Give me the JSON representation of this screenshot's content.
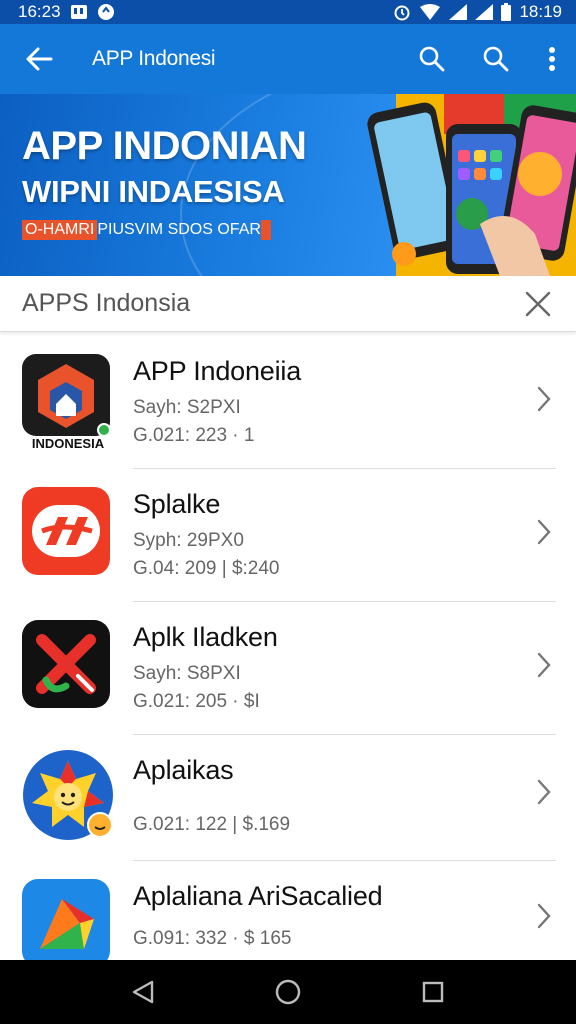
{
  "status_bar": {
    "time_left": "16:23",
    "time_right": "18:19"
  },
  "app_bar": {
    "title": "APP Indonesi",
    "icons": [
      "back-arrow-icon",
      "search-icon",
      "search-icon",
      "more-vert-icon"
    ]
  },
  "banner": {
    "line1": "APP INDONIAN",
    "line2": "WIPNI INDAESISA",
    "tag_highlight": "O-HAMRI",
    "tag_text": " PIUSVIM SDOS OFAR"
  },
  "search": {
    "query": "APPS Indonsia"
  },
  "apps": [
    {
      "name": "APP Indoneiia",
      "meta": "Sayh: S2PXI",
      "meta2": "G.021: 223 · 1",
      "icon_label": "INDONESIA",
      "icon": "indonesia-app-icon"
    },
    {
      "name": "Splalke",
      "meta": "Syph: 29PX0",
      "meta2": "G.04: 209 | $:240",
      "icon": "splalke-app-icon"
    },
    {
      "name": "Aplk Iladken",
      "meta": "Sayh: S8PXI",
      "meta2": "G.021: 205 · $I",
      "icon": "aplk-app-icon"
    },
    {
      "name": "Aplaikas",
      "meta": "",
      "meta2": "G.021: 122 | $.169",
      "icon": "aplaikas-app-icon"
    },
    {
      "name": "Aplaliana AriSacalied",
      "meta": "",
      "meta2": "G.091: 332 · $ 165",
      "icon": "aplaliana-app-icon"
    }
  ],
  "colors": {
    "app_bar": "#1478d8",
    "status_bar": "#0b4fa8",
    "banner_tag": "#e8532b"
  }
}
